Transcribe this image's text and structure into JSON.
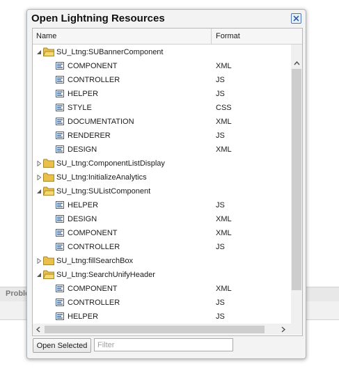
{
  "background": {
    "tab_label": "Proble"
  },
  "dialog": {
    "title": "Open Lightning Resources",
    "close_icon": "close-x-icon",
    "columns": {
      "name": "Name",
      "format": "Format"
    },
    "open_button": "Open Selected",
    "filter_placeholder": "Filter"
  },
  "tree": [
    {
      "type": "bundle",
      "name": "SU_Ltng:SUBannerComponent",
      "expanded": true
    },
    {
      "type": "file",
      "name": "COMPONENT",
      "format": "XML"
    },
    {
      "type": "file",
      "name": "CONTROLLER",
      "format": "JS"
    },
    {
      "type": "file",
      "name": "HELPER",
      "format": "JS"
    },
    {
      "type": "file",
      "name": "STYLE",
      "format": "CSS"
    },
    {
      "type": "file",
      "name": "DOCUMENTATION",
      "format": "XML"
    },
    {
      "type": "file",
      "name": "RENDERER",
      "format": "JS"
    },
    {
      "type": "file",
      "name": "DESIGN",
      "format": "XML"
    },
    {
      "type": "bundle",
      "name": "SU_Ltng:ComponentListDisplay",
      "expanded": false
    },
    {
      "type": "bundle",
      "name": "SU_Ltng:InitializeAnalytics",
      "expanded": false
    },
    {
      "type": "bundle",
      "name": "SU_Ltng:SUListComponent",
      "expanded": true
    },
    {
      "type": "file",
      "name": "HELPER",
      "format": "JS"
    },
    {
      "type": "file",
      "name": "DESIGN",
      "format": "XML"
    },
    {
      "type": "file",
      "name": "COMPONENT",
      "format": "XML"
    },
    {
      "type": "file",
      "name": "CONTROLLER",
      "format": "JS"
    },
    {
      "type": "bundle",
      "name": "SU_Ltng:fillSearchBox",
      "expanded": false
    },
    {
      "type": "bundle",
      "name": "SU_Ltng:SearchUnifyHeader",
      "expanded": true
    },
    {
      "type": "file",
      "name": "COMPONENT",
      "format": "XML"
    },
    {
      "type": "file",
      "name": "CONTROLLER",
      "format": "JS"
    },
    {
      "type": "file",
      "name": "HELPER",
      "format": "JS"
    }
  ],
  "colors": {
    "folder": "#e8c04a",
    "accent": "#4a76b8",
    "file_icon": "#3d5f94"
  }
}
